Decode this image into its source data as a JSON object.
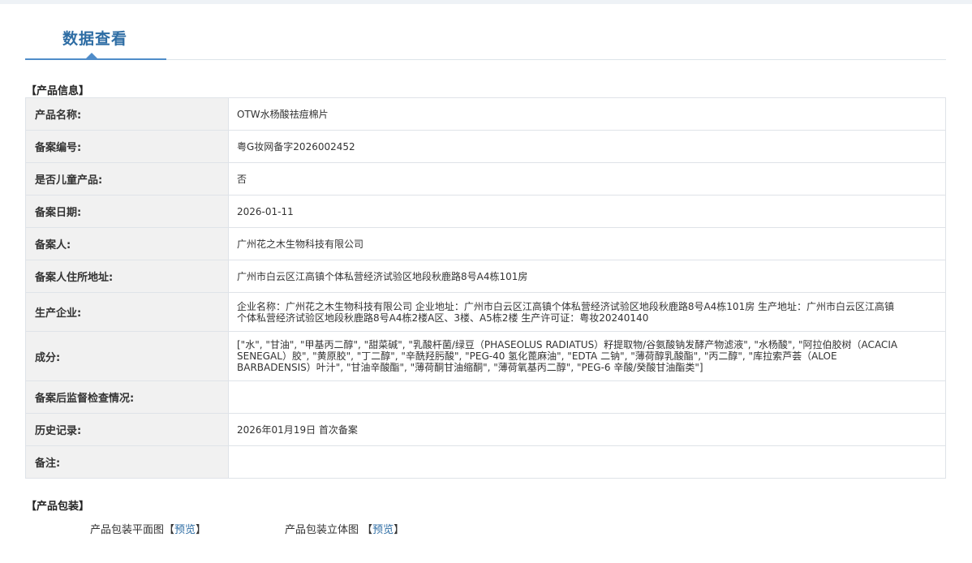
{
  "tab": {
    "title": "数据查看"
  },
  "product_info": {
    "section_title": "【产品信息】",
    "rows": [
      {
        "label": "产品名称:",
        "value": "OTW水杨酸祛痘棉片"
      },
      {
        "label": "备案编号:",
        "value": "粤G妆网备字2026002452"
      },
      {
        "label": "是否儿童产品:",
        "value": "否"
      },
      {
        "label": "备案日期:",
        "value": "2026-01-11"
      },
      {
        "label": "备案人:",
        "value": "广州花之木生物科技有限公司"
      },
      {
        "label": "备案人住所地址:",
        "value": "广州市白云区江高镇个体私营经济试验区地段秋鹿路8号A4栋101房"
      },
      {
        "label": "生产企业:",
        "value": "企业名称：广州花之木生物科技有限公司 企业地址：广州市白云区江高镇个体私营经济试验区地段秋鹿路8号A4栋101房 生产地址：广州市白云区江高镇个体私营经济试验区地段秋鹿路8号A4栋2楼A区、3楼、A5栋2楼 生产许可证：粤妆20240140"
      },
      {
        "label": "成分:",
        "value": "[\"水\", \"甘油\", \"甲基丙二醇\", \"甜菜碱\", \"乳酸杆菌/绿豆（PHASEOLUS RADIATUS）籽提取物/谷氨酸钠发酵产物滤液\", \"水杨酸\", \"阿拉伯胶树（ACACIA SENEGAL）胶\", \"黄原胶\", \"丁二醇\", \"辛酰羟肟酸\", \"PEG-40 氢化蓖麻油\", \"EDTA 二钠\", \"薄荷醇乳酸酯\", \"丙二醇\", \"库拉索芦荟（ALOE BARBADENSIS）叶汁\", \"甘油辛酸酯\", \"薄荷酮甘油缩酮\", \"薄荷氧基丙二醇\", \"PEG-6 辛酸/癸酸甘油酯类\"]"
      },
      {
        "label": "备案后监督检查情况:",
        "value": ""
      },
      {
        "label": "历史记录:",
        "value": "2026年01月19日 首次备案"
      },
      {
        "label": "备注:",
        "value": ""
      }
    ]
  },
  "packaging": {
    "section_title": "【产品包装】",
    "flat_label": "产品包装平面图",
    "flat_link": "预览",
    "stereo_label": "产品包装立体图 ",
    "stereo_link": "预览",
    "bracket_open": "【",
    "bracket_close": "】"
  }
}
